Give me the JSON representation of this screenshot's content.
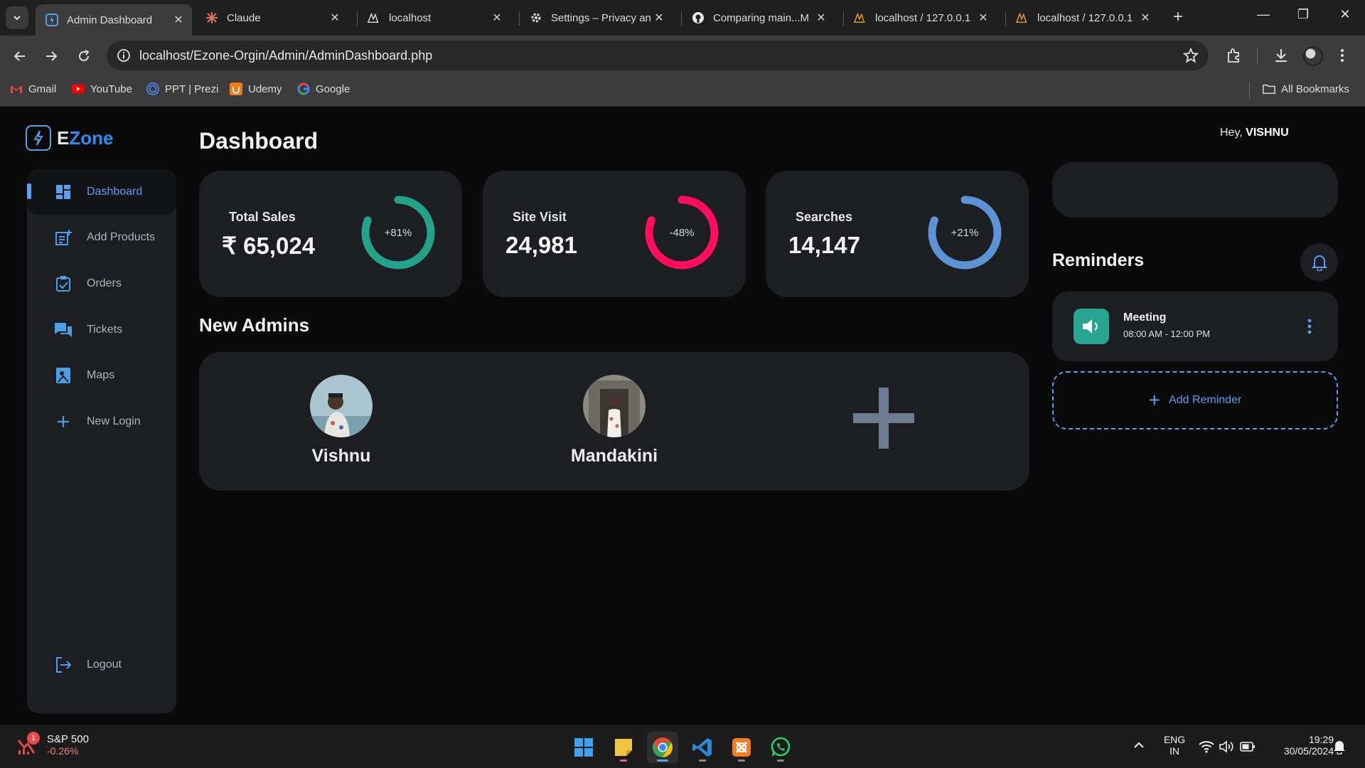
{
  "browser": {
    "tabs": [
      {
        "title": "Admin Dashboard",
        "icon": "ezone-favicon",
        "active": true
      },
      {
        "title": "Claude",
        "icon": "claude-icon"
      },
      {
        "title": "localhost",
        "icon": "phpmyadmin-icon"
      },
      {
        "title": "Settings – Privacy an",
        "icon": "gear-icon"
      },
      {
        "title": "Comparing main...M",
        "icon": "github-icon"
      },
      {
        "title": "localhost / 127.0.0.1",
        "icon": "phpmyadmin-icon"
      },
      {
        "title": "localhost / 127.0.0.1",
        "icon": "phpmyadmin-icon"
      }
    ],
    "url": "localhost/Ezone-Orgin/Admin/AdminDashboard.php",
    "bookmarks": [
      {
        "label": "Gmail",
        "icon": "gmail-icon"
      },
      {
        "label": "YouTube",
        "icon": "youtube-icon"
      },
      {
        "label": "PPT | Prezi",
        "icon": "prezi-icon"
      },
      {
        "label": "Udemy",
        "icon": "udemy-icon"
      },
      {
        "label": "Google",
        "icon": "google-icon"
      }
    ],
    "all_bookmarks": "All Bookmarks"
  },
  "app": {
    "logo": {
      "prefix": "E",
      "name": "Zone"
    },
    "sidebar": [
      {
        "label": "Dashboard",
        "icon": "dashboard-icon",
        "active": true
      },
      {
        "label": "Add Products",
        "icon": "add-products-icon"
      },
      {
        "label": "Orders",
        "icon": "orders-icon"
      },
      {
        "label": "Tickets",
        "icon": "tickets-icon"
      },
      {
        "label": "Maps",
        "icon": "maps-icon"
      },
      {
        "label": "New Login",
        "icon": "plus-icon"
      }
    ],
    "logout": "Logout",
    "page_title": "Dashboard",
    "greeting": {
      "prefix": "Hey,",
      "user": "VISHNU"
    },
    "stats": [
      {
        "label": "Total Sales",
        "value": "₹ 65,024",
        "change": "+81%",
        "progress": 0.81,
        "color": "#23a28b"
      },
      {
        "label": "Site Visit",
        "value": "24,981",
        "change": "-48%",
        "progress": 0.81,
        "color": "#ff0f5b"
      },
      {
        "label": "Searches",
        "value": "14,147",
        "change": "+21%",
        "progress": 0.81,
        "color": "#5b93d4"
      }
    ],
    "new_admins_title": "New Admins",
    "admins": [
      {
        "name": "Vishnu"
      },
      {
        "name": "Mandakini"
      }
    ],
    "reminders_title": "Reminders",
    "reminder": {
      "title": "Meeting",
      "time": "08:00 AM - 12:00 PM"
    },
    "add_reminder": "Add Reminder"
  },
  "taskbar": {
    "widget": {
      "badge": "1",
      "title": "S&P 500",
      "change": "-0.26%"
    },
    "lang": "ENG",
    "region": "IN",
    "time": "19:29",
    "date": "30/05/2024"
  }
}
